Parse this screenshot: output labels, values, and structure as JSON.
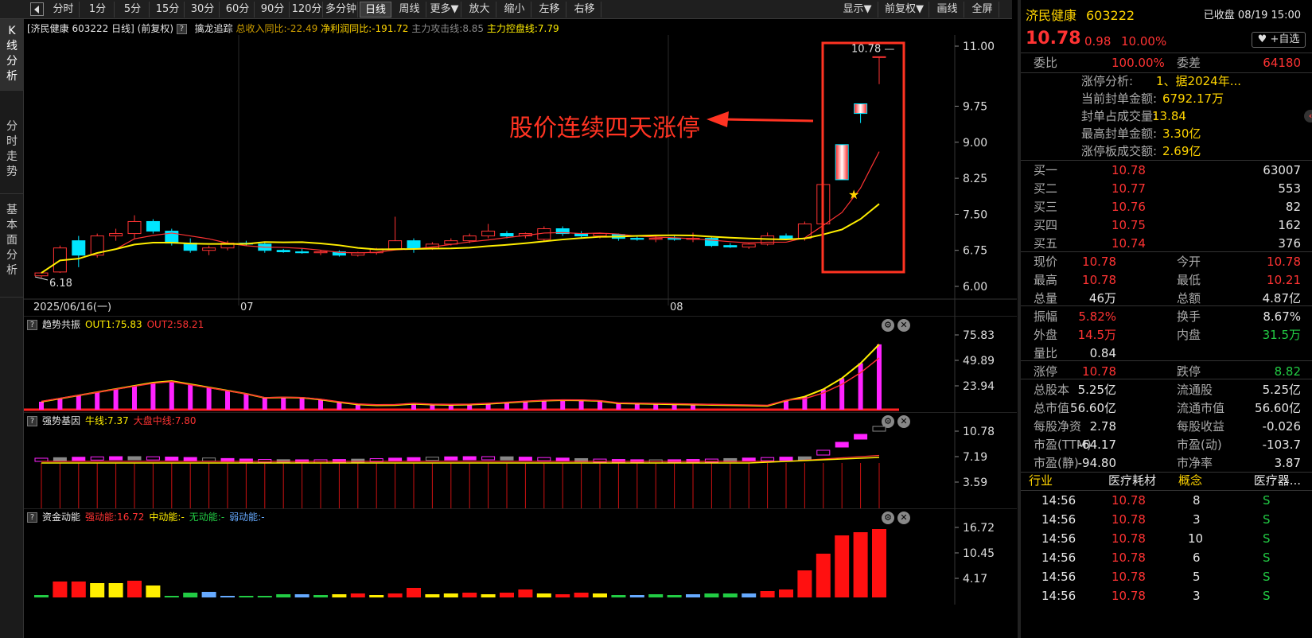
{
  "toolbar": {
    "periods": [
      "分时",
      "1分",
      "5分",
      "15分",
      "30分",
      "60分",
      "90分",
      "120分",
      "多分钟",
      "日线",
      "周线",
      "更多▼",
      "放大",
      "缩小",
      "左移",
      "右移"
    ],
    "active_period": "日线",
    "right_buttons": [
      "显示▼",
      "前复权▼",
      "画线",
      "全屏"
    ]
  },
  "sidebar": {
    "tabs": [
      {
        "label": "K线分析",
        "active": true
      },
      {
        "label": "分时走势",
        "active": false
      },
      {
        "label": "基本面分析",
        "active": false
      }
    ]
  },
  "main": {
    "header": {
      "stock": "[济民健康 603222 日线]",
      "adjust": "(前复权)",
      "indicator": "擒龙追踪",
      "revenue": "总收入同比:-22.49",
      "profit": "净利润同比:-191.72",
      "attack": "主力攻击线:8.85",
      "control": "主力控盘线:7.79"
    },
    "price_axis": [
      "11.00",
      "9.75",
      "9.00",
      "8.25",
      "7.50",
      "6.75",
      "6.00"
    ],
    "date_labels": [
      "2025/06/16(一)",
      "07",
      "08"
    ],
    "last_price_label": "10.78",
    "low_label": "6.18",
    "annotation": "股价连续四天涨停",
    "annotation_color": "#ff3322"
  },
  "panels": [
    {
      "name": "趋势共振",
      "a_label": "OUT1:75.83",
      "b_label": "OUT2:58.21",
      "c_label": "",
      "d_label": "",
      "axis": [
        "75.83",
        "49.89",
        "23.94"
      ]
    },
    {
      "name": "强势基因",
      "a_label": "牛线:7.37",
      "b_label": "大盘中线:7.80",
      "c_label": "",
      "d_label": "",
      "axis": [
        "10.78",
        "7.19",
        "3.59"
      ]
    },
    {
      "name": "资金动能",
      "a_label": "强动能:16.72",
      "b_label": "中动能:-",
      "c_label": "无动能:-",
      "d_label": "弱动能:-",
      "axis": [
        "16.72",
        "10.45",
        "4.17"
      ]
    }
  ],
  "chart_data": {
    "type": "candlestick",
    "dates": [
      "2025/06/16",
      "07",
      "08"
    ],
    "ylim": [
      6.0,
      11.0
    ],
    "candles": [
      [
        6.22,
        6.3,
        6.18,
        6.28
      ],
      [
        6.3,
        6.85,
        6.28,
        6.8
      ],
      [
        6.95,
        7.05,
        6.4,
        6.65
      ],
      [
        6.65,
        7.1,
        6.6,
        7.05
      ],
      [
        7.05,
        7.2,
        6.95,
        7.1
      ],
      [
        7.1,
        7.48,
        7.0,
        7.35
      ],
      [
        7.35,
        7.4,
        7.1,
        7.15
      ],
      [
        7.15,
        7.2,
        6.85,
        6.9
      ],
      [
        6.9,
        7.0,
        6.7,
        6.75
      ],
      [
        6.75,
        6.85,
        6.65,
        6.8
      ],
      [
        6.8,
        6.95,
        6.75,
        6.9
      ],
      [
        6.9,
        6.95,
        6.85,
        6.88
      ],
      [
        6.88,
        6.92,
        6.7,
        6.75
      ],
      [
        6.75,
        6.78,
        6.7,
        6.72
      ],
      [
        6.72,
        6.78,
        6.68,
        6.7
      ],
      [
        6.7,
        6.75,
        6.65,
        6.72
      ],
      [
        6.72,
        6.75,
        6.62,
        6.65
      ],
      [
        6.65,
        6.72,
        6.62,
        6.7
      ],
      [
        6.7,
        6.8,
        6.66,
        6.78
      ],
      [
        6.78,
        7.45,
        6.75,
        6.95
      ],
      [
        6.95,
        7.0,
        6.7,
        6.8
      ],
      [
        6.8,
        6.92,
        6.76,
        6.88
      ],
      [
        6.88,
        7.0,
        6.85,
        6.95
      ],
      [
        6.95,
        7.1,
        6.9,
        7.05
      ],
      [
        7.05,
        7.3,
        7.0,
        7.15
      ],
      [
        7.1,
        7.15,
        7.0,
        7.05
      ],
      [
        7.05,
        7.12,
        7.0,
        7.1
      ],
      [
        6.98,
        7.25,
        6.95,
        7.2
      ],
      [
        7.2,
        7.25,
        7.05,
        7.1
      ],
      [
        7.1,
        7.15,
        7.0,
        7.05
      ],
      [
        7.05,
        7.12,
        7.0,
        7.1
      ],
      [
        7.08,
        7.1,
        6.95,
        7.0
      ],
      [
        7.0,
        7.05,
        6.95,
        6.98
      ],
      [
        6.98,
        7.05,
        6.92,
        7.0
      ],
      [
        7.0,
        7.05,
        6.95,
        6.98
      ],
      [
        6.98,
        7.12,
        6.92,
        7.0
      ],
      [
        7.0,
        7.05,
        6.82,
        6.85
      ],
      [
        6.85,
        6.9,
        6.8,
        6.82
      ],
      [
        6.82,
        6.9,
        6.78,
        6.88
      ],
      [
        6.88,
        7.12,
        6.85,
        7.05
      ],
      [
        7.05,
        7.1,
        6.98,
        7.0
      ],
      [
        7.0,
        7.35,
        6.95,
        7.3
      ],
      [
        7.3,
        8.12,
        7.25,
        8.12
      ],
      [
        8.95,
        8.95,
        8.22,
        8.22
      ],
      [
        9.8,
        9.8,
        9.4,
        9.6
      ],
      [
        10.78,
        10.78,
        10.21,
        10.78
      ]
    ],
    "ma_attack_last": 8.85,
    "ma_control_last": 7.79,
    "trend_panel": {
      "out1": 75.83,
      "out2": 58.21,
      "ylim": [
        0,
        80
      ]
    },
    "gene_panel": {
      "bull": 7.37,
      "market": 7.8,
      "ylim": [
        2.5,
        11.5
      ]
    },
    "fund_panel": {
      "strong": 16.72,
      "ylim": [
        0,
        17
      ]
    }
  },
  "quote": {
    "name": "济民健康",
    "code": "603222",
    "status": "已收盘 08/19 15:00",
    "price": "10.78",
    "change": "0.98",
    "pct": "10.00%",
    "watch_btn": "+自选",
    "webi_label": "委比",
    "webi": "100.00%",
    "weicha_label": "委差",
    "weicha": "64180",
    "limit_analysis": [
      {
        "k": "涨停分析:",
        "v": "1、据2024年..."
      },
      {
        "k": "当前封单金额:",
        "v": "6792.17万"
      },
      {
        "k": "封单占成交量:",
        "v": "13.84"
      },
      {
        "k": "最高封单金额:",
        "v": "3.30亿"
      },
      {
        "k": "涨停板成交额:",
        "v": "2.69亿"
      }
    ],
    "bids": [
      {
        "k": "买一",
        "p": "10.78",
        "v": "63007"
      },
      {
        "k": "买二",
        "p": "10.77",
        "v": "553"
      },
      {
        "k": "买三",
        "p": "10.76",
        "v": "82"
      },
      {
        "k": "买四",
        "p": "10.75",
        "v": "162"
      },
      {
        "k": "买五",
        "p": "10.74",
        "v": "376"
      }
    ],
    "stats": [
      {
        "k1": "现价",
        "v1": "10.78",
        "c1": "red",
        "k2": "今开",
        "v2": "10.78",
        "c2": "red"
      },
      {
        "k1": "最高",
        "v1": "10.78",
        "c1": "red",
        "k2": "最低",
        "v2": "10.21",
        "c2": "red"
      },
      {
        "k1": "总量",
        "v1": "46万",
        "c1": "white",
        "k2": "总额",
        "v2": "4.87亿",
        "c2": "white"
      },
      {
        "k1": "振幅",
        "v1": "5.82%",
        "c1": "red",
        "k2": "换手",
        "v2": "8.67%",
        "c2": "white"
      },
      {
        "k1": "外盘",
        "v1": "14.5万",
        "c1": "red",
        "k2": "内盘",
        "v2": "31.5万",
        "c2": "green"
      },
      {
        "k1": "量比",
        "v1": "0.84",
        "c1": "white",
        "k2": "",
        "v2": "",
        "c2": "white"
      },
      {
        "k1": "涨停",
        "v1": "10.78",
        "c1": "red",
        "k2": "跌停",
        "v2": "8.82",
        "c2": "green"
      },
      {
        "k1": "总股本",
        "v1": "5.25亿",
        "c1": "white",
        "k2": "流通股",
        "v2": "5.25亿",
        "c2": "white"
      },
      {
        "k1": "总市值",
        "v1": "56.60亿",
        "c1": "white",
        "k2": "流通市值",
        "v2": "56.60亿",
        "c2": "white"
      },
      {
        "k1": "每股净资",
        "v1": "2.78",
        "c1": "white",
        "k2": "每股收益",
        "v2": "-0.026",
        "c2": "white"
      },
      {
        "k1": "市盈(TTM)",
        "v1": "-64.17",
        "c1": "white",
        "k2": "市盈(动)",
        "v2": "-103.7",
        "c2": "white"
      },
      {
        "k1": "市盈(静)",
        "v1": "-94.80",
        "c1": "white",
        "k2": "市净率",
        "v2": "3.87",
        "c2": "white"
      }
    ],
    "industry_label": "行业",
    "industry": "医疗耗材",
    "concept_label": "概念",
    "concept": "医疗器...",
    "ticks": [
      {
        "t": "14:56",
        "p": "10.78",
        "v": "8",
        "s": "S"
      },
      {
        "t": "14:56",
        "p": "10.78",
        "v": "3",
        "s": "S"
      },
      {
        "t": "14:56",
        "p": "10.78",
        "v": "10",
        "s": "S"
      },
      {
        "t": "14:56",
        "p": "10.78",
        "v": "6",
        "s": "S"
      },
      {
        "t": "14:56",
        "p": "10.78",
        "v": "5",
        "s": "S"
      },
      {
        "t": "14:56",
        "p": "10.78",
        "v": "3",
        "s": "S"
      }
    ]
  }
}
